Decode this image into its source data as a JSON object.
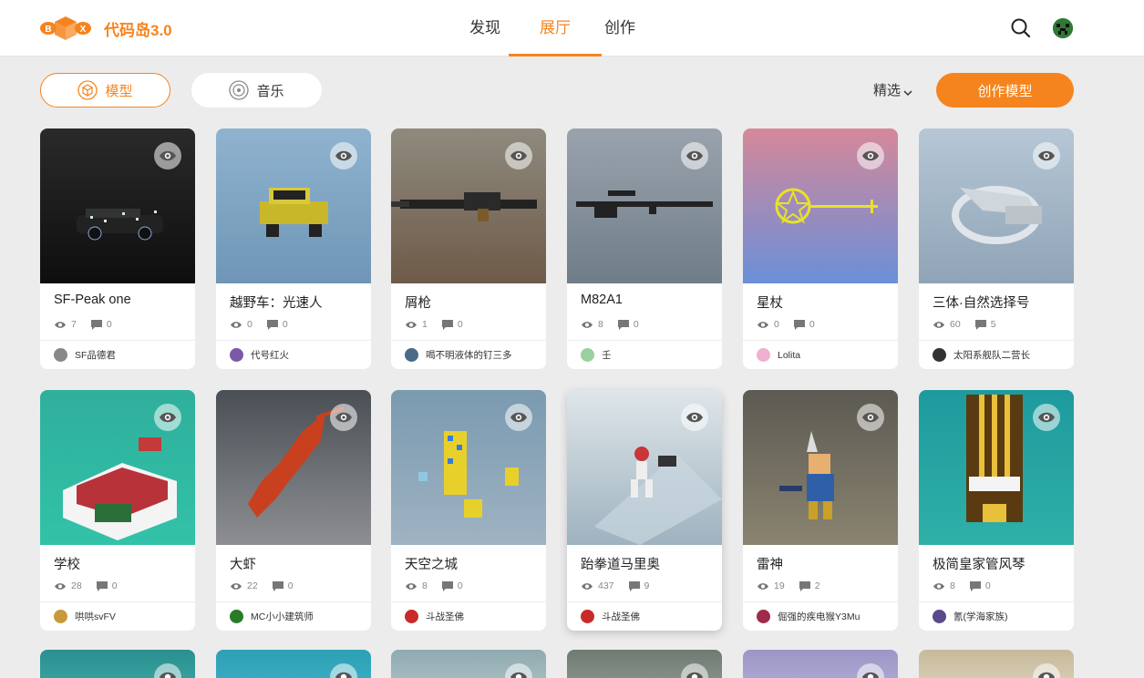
{
  "app": {
    "name": "代码岛3.0",
    "logo_letters": [
      "B",
      "X"
    ]
  },
  "nav": {
    "tabs": [
      {
        "label": "发现",
        "active": false
      },
      {
        "label": "展厅",
        "active": true
      },
      {
        "label": "创作",
        "active": false
      }
    ]
  },
  "toolbar": {
    "model_label": "模型",
    "music_label": "音乐",
    "filter_label": "精选",
    "create_label": "创作模型"
  },
  "colors": {
    "accent": "#f5841f"
  },
  "icons": {
    "search": "search-icon",
    "eye": "eye-icon",
    "views": "view-count-icon",
    "comments": "comment-icon"
  },
  "cards": [
    {
      "title": "SF-Peak one",
      "views": "7",
      "comments": "0",
      "author": "SF品德君"
    },
    {
      "title": "越野车：光速人",
      "views": "0",
      "comments": "0",
      "author": "代号红火"
    },
    {
      "title": "屑枪",
      "views": "1",
      "comments": "0",
      "author": "喝不明液体的钉三多"
    },
    {
      "title": "M82A1",
      "views": "8",
      "comments": "0",
      "author": "壬"
    },
    {
      "title": "星杖",
      "views": "0",
      "comments": "0",
      "author": "Lolita"
    },
    {
      "title": "三体·自然选择号",
      "views": "60",
      "comments": "5",
      "author": "太阳系舰队二营长"
    },
    {
      "title": "学校",
      "views": "28",
      "comments": "0",
      "author": "哄哄svFV"
    },
    {
      "title": "大虾",
      "views": "22",
      "comments": "0",
      "author": "MC小小建筑师"
    },
    {
      "title": "天空之城",
      "views": "8",
      "comments": "0",
      "author": "斗战圣佛"
    },
    {
      "title": "跆拳道马里奥",
      "views": "437",
      "comments": "9",
      "author": "斗战圣佛"
    },
    {
      "title": "雷神",
      "views": "19",
      "comments": "2",
      "author": "倔强的疾电猴Y3Mu"
    },
    {
      "title": "极简皇家管风琴",
      "views": "8",
      "comments": "0",
      "author": "氰(学海家族)"
    }
  ]
}
